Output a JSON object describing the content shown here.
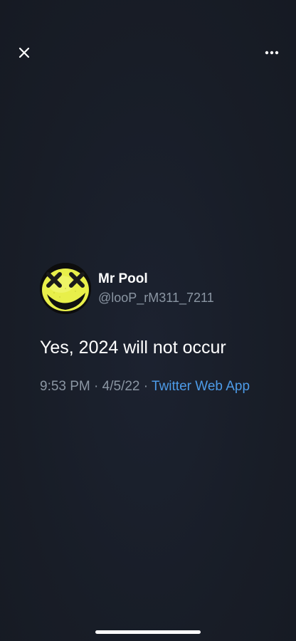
{
  "top_bar": {
    "close_icon": "close-icon",
    "more_icon": "more-horizontal-icon"
  },
  "tweet": {
    "author": {
      "display_name": "Mr Pool",
      "handle": "@looP_rM311_7211",
      "avatar_icon": "avatar-yellow-x-eyes-smiley"
    },
    "text": "Yes, 2024 will not occur",
    "time": "9:53 PM",
    "separator": "·",
    "date": "4/5/22",
    "source": "Twitter Web App"
  },
  "colors": {
    "background": "#1a1f29",
    "text_primary": "#ffffff",
    "text_secondary": "#8b96a3",
    "link": "#4d9be8",
    "avatar_yellow": "#e8ef4a"
  }
}
